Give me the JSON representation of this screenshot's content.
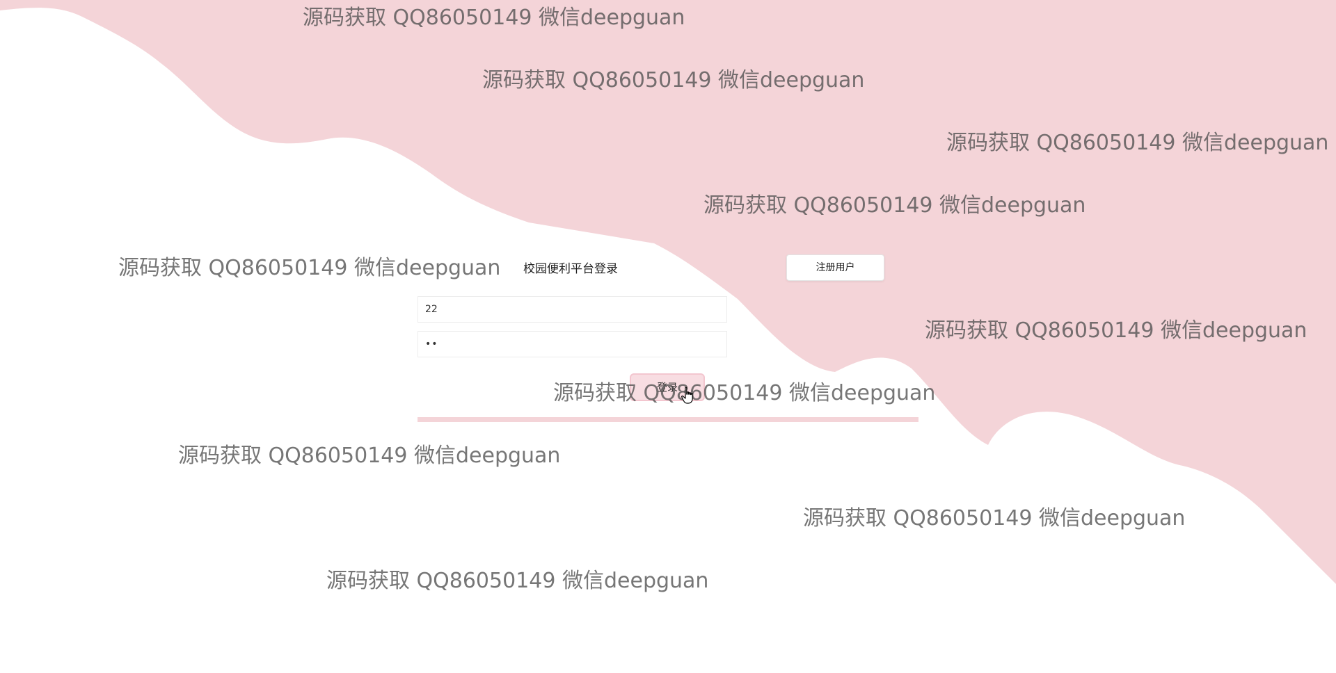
{
  "colors": {
    "background": "#ffffff",
    "wave": "#f4d4d8",
    "accent": "#f3c6cf",
    "watermark": "#505050"
  },
  "login": {
    "title": "校园便利平台登录",
    "register_label": "注册用户",
    "username_value": "22",
    "password_value": "••",
    "submit_label": "登录"
  },
  "watermark": {
    "text": "源码获取 QQ86050149 微信deepguan"
  },
  "icons": {
    "cursor": "hand-pointer-icon"
  }
}
